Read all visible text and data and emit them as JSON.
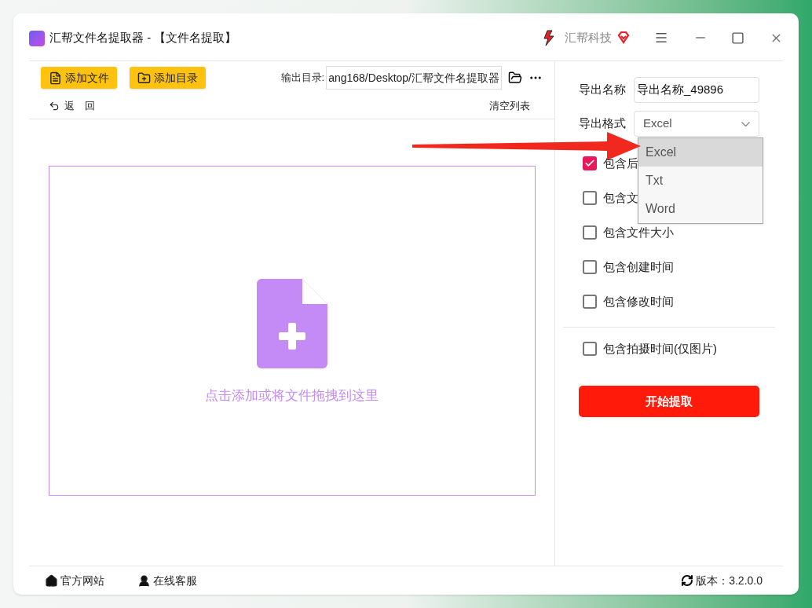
{
  "window": {
    "title": "汇帮文件名提取器 - 【文件名提取】",
    "brand": "汇帮科技"
  },
  "toolbar": {
    "buttons": [
      {
        "label": "添加文件",
        "kind": "file"
      },
      {
        "label": "添加目录",
        "kind": "folder"
      }
    ],
    "output_label": "输出目录:",
    "output_path": "ang168/Desktop/汇帮文件名提取器",
    "back": "返　回",
    "clear": "清空列表"
  },
  "drop_area": {
    "hint": "点击添加或将文件拖拽到这里"
  },
  "settings": {
    "name_label": "导出名称",
    "name_value": "导出名称_49896",
    "format_label": "导出格式",
    "format_value": "Excel",
    "format_options": [
      {
        "label": "Excel",
        "selected": true
      },
      {
        "label": "Txt",
        "selected": false
      },
      {
        "label": "Word",
        "selected": false
      }
    ],
    "options": [
      {
        "label": "包含后",
        "checked": true
      },
      {
        "label": "包含文",
        "checked": false
      },
      {
        "label": "包含文件大小",
        "checked": false
      },
      {
        "label": "包含创建时间",
        "checked": false
      },
      {
        "label": "包含修改时间",
        "checked": false
      }
    ],
    "extra_options": [
      {
        "label": "包含拍摄时间(仅图片)",
        "checked": false
      }
    ],
    "start_button": "开始提取"
  },
  "footer": {
    "links": [
      {
        "label": "官方网站",
        "kind": "home"
      },
      {
        "label": "在线客服",
        "kind": "support"
      }
    ],
    "version": "版本：3.2.0.0"
  }
}
